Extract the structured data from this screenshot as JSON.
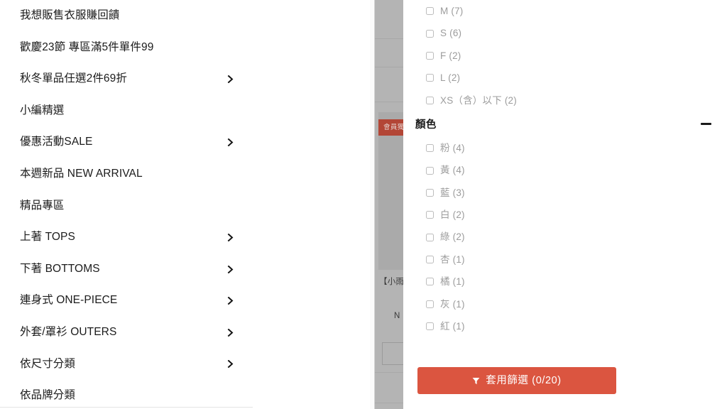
{
  "nav_menu": {
    "items": [
      {
        "label": "我想販售衣服賺回饋",
        "has_chevron": false
      },
      {
        "label": "歡慶23節 專區滿5件單件99",
        "has_chevron": false
      },
      {
        "label": "秋冬單品任選2件69折",
        "has_chevron": true
      },
      {
        "label": "小編精選",
        "has_chevron": false
      },
      {
        "label": "優惠活動SALE",
        "has_chevron": true
      },
      {
        "label": "本週新品 NEW ARRIVAL",
        "has_chevron": false
      },
      {
        "label": "精品專區",
        "has_chevron": false
      },
      {
        "label": "上著 TOPS",
        "has_chevron": true
      },
      {
        "label": "下著 BOTTOMS",
        "has_chevron": true
      },
      {
        "label": "連身式 ONE-PIECE",
        "has_chevron": true
      },
      {
        "label": "外套/罩衫 OUTERS",
        "has_chevron": true
      },
      {
        "label": "依尺寸分類",
        "has_chevron": true
      },
      {
        "label": "依品牌分類",
        "has_chevron": false
      }
    ],
    "chevron_icon": "chevron-right-icon"
  },
  "dimmed_page": {
    "badge_text": "會員獨",
    "product_title": "【小雨",
    "price_fragment": "N"
  },
  "filter_panel": {
    "size_group": {
      "options": [
        {
          "label": "M (7)",
          "checked": false
        },
        {
          "label": "S (6)",
          "checked": false
        },
        {
          "label": "F (2)",
          "checked": false
        },
        {
          "label": "L (2)",
          "checked": false
        },
        {
          "label": "XS（含）以下 (2)",
          "checked": false
        }
      ]
    },
    "color_group": {
      "title": "顏色",
      "collapse_icon": "minus-icon",
      "options": [
        {
          "label": "粉 (4)",
          "checked": false
        },
        {
          "label": "黃 (4)",
          "checked": false
        },
        {
          "label": "藍 (3)",
          "checked": false
        },
        {
          "label": "白 (2)",
          "checked": false
        },
        {
          "label": "綠 (2)",
          "checked": false
        },
        {
          "label": "杏 (1)",
          "checked": false
        },
        {
          "label": "橘 (1)",
          "checked": false
        },
        {
          "label": "灰 (1)",
          "checked": false
        },
        {
          "label": "紅 (1)",
          "checked": false
        }
      ]
    },
    "apply_button": {
      "label": "套用篩選 (0/20)",
      "icon": "funnel-icon",
      "color": "#db5540",
      "text_color": "#ffffff"
    }
  }
}
